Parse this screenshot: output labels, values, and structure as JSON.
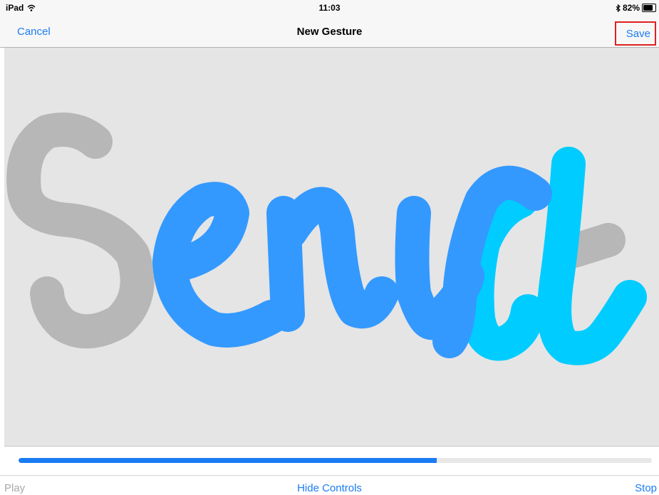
{
  "status_bar": {
    "device": "iPad",
    "wifi_icon": "wifi-icon",
    "time": "11:03",
    "bluetooth_icon": "bluetooth-icon",
    "battery_percent": "82%",
    "battery_level": 0.82
  },
  "nav": {
    "cancel_label": "Cancel",
    "title": "New Gesture",
    "save_label": "Save"
  },
  "canvas": {
    "background": "#e5e5e5",
    "stroke_colors": {
      "past": "#b7b7b7",
      "current": "#3399ff",
      "recent": "#00ccff"
    }
  },
  "playback": {
    "progress": 0.66,
    "progress_color": "#1a7cf5"
  },
  "toolbar": {
    "play_label": "Play",
    "hide_controls_label": "Hide Controls",
    "stop_label": "Stop"
  }
}
